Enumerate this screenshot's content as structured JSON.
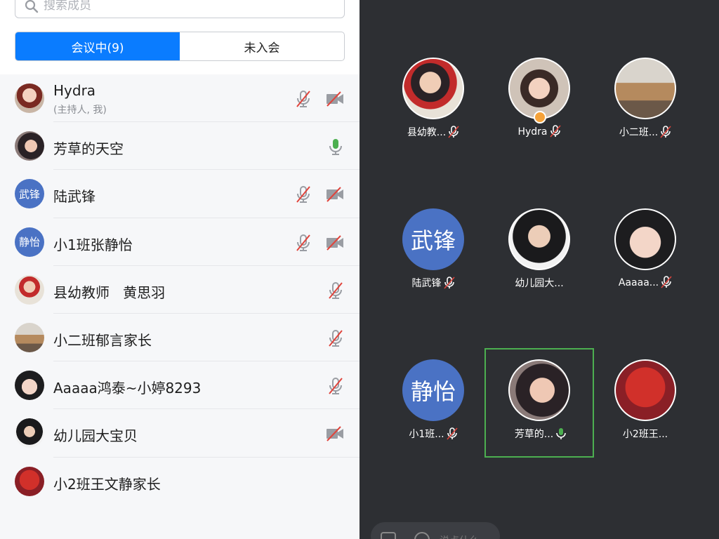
{
  "search": {
    "placeholder": "搜索成员"
  },
  "tabs": [
    {
      "label": "会议中(9)",
      "active": true
    },
    {
      "label": "未入会",
      "active": false
    }
  ],
  "members": [
    {
      "name": "Hydra",
      "sub": "(主持人, 我)",
      "avatar": "photo",
      "mic": "muted",
      "cam": "off"
    },
    {
      "name": "芳草的天空",
      "avatar": "photo",
      "mic": "on"
    },
    {
      "name": "陆武锋",
      "avatar_text": "武锋",
      "mic": "muted",
      "cam": "off"
    },
    {
      "name": "小1班张静怡",
      "avatar_text": "静怡",
      "mic": "muted",
      "cam": "off"
    },
    {
      "name": "县幼教师   黄思羽",
      "avatar": "photo",
      "mic": "muted"
    },
    {
      "name": "小二班郁言家长",
      "avatar": "photo",
      "mic": "muted"
    },
    {
      "name": "Aaaaa鸿泰~小婷8293",
      "avatar": "photo",
      "mic": "muted"
    },
    {
      "name": "幼儿园大宝贝",
      "avatar": "photo",
      "cam": "off"
    },
    {
      "name": "小2班王文静家长",
      "avatar": "photo"
    }
  ],
  "grid": [
    {
      "label": "县幼教...",
      "avatar": "photo",
      "mic": "muted"
    },
    {
      "label": "Hydra",
      "avatar": "photo",
      "mic": "muted",
      "host": true
    },
    {
      "label": "小二班...",
      "avatar": "photo",
      "mic": "muted"
    },
    {
      "label": "陆武锋",
      "avatar_text": "武锋",
      "mic": "muted"
    },
    {
      "label": "幼儿园大...",
      "avatar": "photo"
    },
    {
      "label": "Aaaaa...",
      "avatar": "photo",
      "mic": "muted"
    },
    {
      "label": "小1班...",
      "avatar_text": "静怡",
      "mic": "muted"
    },
    {
      "label": "芳草的...",
      "avatar": "photo",
      "mic": "on",
      "speaking": true
    },
    {
      "label": "小2班王..."
    }
  ],
  "bottom_bar": {
    "text": "说点什么"
  },
  "colors": {
    "accent": "#0a7cff",
    "speaking": "#4caf50",
    "muted_red": "#e0443c",
    "panel_dark": "#2d2f33"
  }
}
